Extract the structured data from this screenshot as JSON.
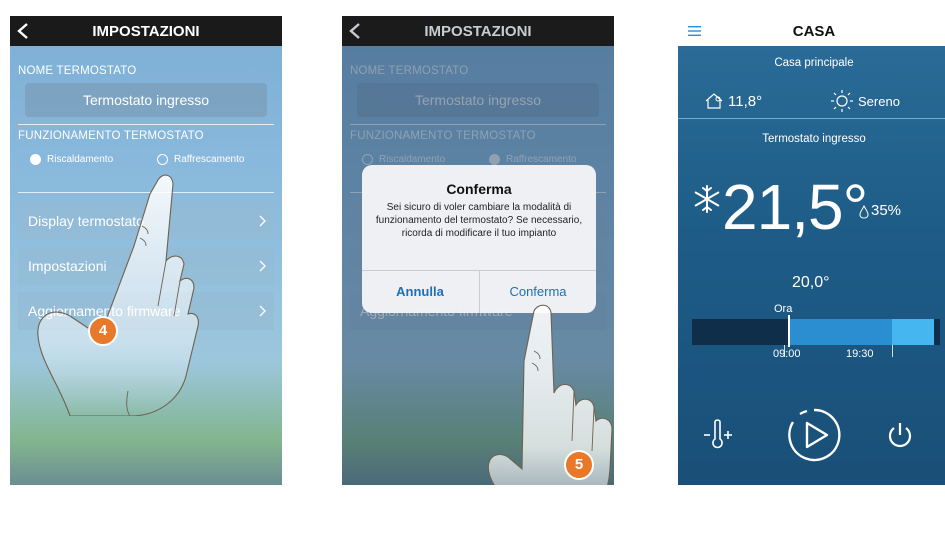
{
  "screen1": {
    "header": {
      "title": "IMPOSTAZIONI"
    },
    "thermostat_name_label": "NOME TERMOSTATO",
    "thermostat_name_value": "Termostato ingresso",
    "mode_label": "FUNZIONAMENTO TERMOSTATO",
    "mode_options": [
      {
        "label": "Riscaldamento",
        "selected": true
      },
      {
        "label": "Raffrescamento",
        "selected": false
      }
    ],
    "menu_items": [
      {
        "label": "Display termostato"
      },
      {
        "label": "Impostazioni"
      },
      {
        "label": "Aggiornamento firmware"
      }
    ],
    "step_badge": "4"
  },
  "screen2": {
    "header": {
      "title": "IMPOSTAZIONI"
    },
    "thermostat_name_label": "NOME TERMOSTATO",
    "thermostat_name_value": "Termostato ingresso",
    "mode_label": "FUNZIONAMENTO TERMOSTATO",
    "mode_options": [
      {
        "label": "Riscaldamento",
        "selected": false
      },
      {
        "label": "Raffrescamento",
        "selected": true
      }
    ],
    "menu_items": [
      {
        "label": "Aggiornamento firmware"
      }
    ],
    "dialog": {
      "title": "Conferma",
      "message": "Sei sicuro di voler cambiare la modalità di funzionamento del termostato? Se necessario, ricorda di modificare il tuo impianto",
      "cancel_label": "Annulla",
      "confirm_label": "Conferma"
    },
    "step_badge": "5"
  },
  "screen3": {
    "header": {
      "title": "CASA"
    },
    "home_name": "Casa principale",
    "outdoor_temp": "11,8°",
    "weather": "Sereno",
    "thermostat_name": "Termostato ingresso",
    "current_temp": "21,5°",
    "humidity": "35%",
    "setpoint": "20,0°",
    "now_label": "Ora",
    "timeline_times": [
      "09:00",
      "19:30"
    ],
    "colors": {
      "accent": "#1d6fb8",
      "bg": "#1e5d88",
      "timeline_active": "#2b8ed0",
      "timeline_light": "#45b6ef"
    }
  }
}
